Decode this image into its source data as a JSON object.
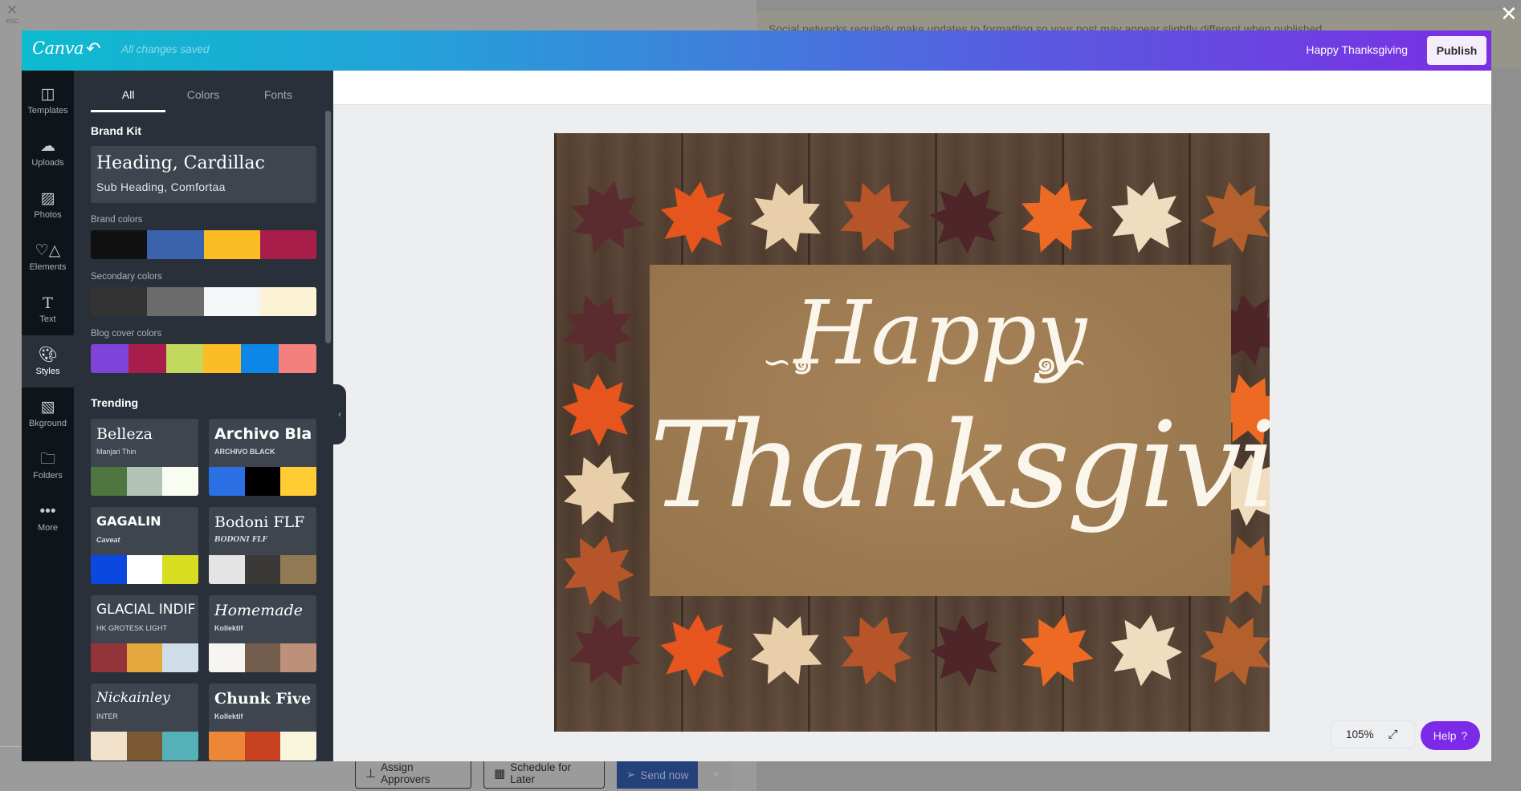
{
  "background": {
    "esc_label": "esc",
    "banner_text": "Social networks regularly make updates to formatting so your post may appear slightly different when published.",
    "buttons": {
      "assign_approvers": "Assign Approvers",
      "schedule_later": "Schedule for Later",
      "send_now": "Send now"
    }
  },
  "header": {
    "logo": "Canva",
    "save_status": "All changes saved",
    "doc_title": "Happy Thanksgiving",
    "publish_label": "Publish"
  },
  "rail": [
    {
      "label": "Templates",
      "icon": "templates-icon"
    },
    {
      "label": "Uploads",
      "icon": "cloud-upload-icon"
    },
    {
      "label": "Photos",
      "icon": "photo-icon"
    },
    {
      "label": "Elements",
      "icon": "shapes-icon"
    },
    {
      "label": "Text",
      "icon": "text-icon"
    },
    {
      "label": "Styles",
      "icon": "palette-icon",
      "active": true
    },
    {
      "label": "Bkground",
      "icon": "background-icon"
    },
    {
      "label": "Folders",
      "icon": "folder-icon"
    },
    {
      "label": "More",
      "icon": "more-icon"
    }
  ],
  "panel": {
    "tabs": [
      "All",
      "Colors",
      "Fonts"
    ],
    "active_tab": "All",
    "brand_kit": {
      "title": "Brand Kit",
      "heading": "Heading, Cardillac",
      "subheading": "Sub Heading, Comfortaa"
    },
    "brand_colors": {
      "title": "Brand colors",
      "colors": [
        "#111111",
        "#3b63ad",
        "#fbbd23",
        "#a91d4b"
      ]
    },
    "secondary_colors": {
      "title": "Secondary colors",
      "colors": [
        "#343334",
        "#6b6b6b",
        "#f4f6f8",
        "#fcf2d6"
      ]
    },
    "blog_cover_colors": {
      "title": "Blog cover colors",
      "colors": [
        "#7e43d8",
        "#a91d4b",
        "#c3d95e",
        "#fbbd23",
        "#0c87e8",
        "#f47f7f"
      ]
    },
    "trending": {
      "title": "Trending",
      "items": [
        {
          "font": "Belleza",
          "sub": "Manjari Thin",
          "colors": [
            "#4f7640",
            "#b1c2b7",
            "#f9fdf1"
          ]
        },
        {
          "font": "Archivo Bla",
          "sub": "ARCHIVO BLACK",
          "colors": [
            "#2a6fe3",
            "#000000",
            "#ffcc33"
          ]
        },
        {
          "font": "GAGALIN",
          "sub": "Caveat",
          "colors": [
            "#0b48e0",
            "#ffffff",
            "#d9dd22"
          ]
        },
        {
          "font": "Bodoni FLF",
          "sub": "BODONI FLF",
          "colors": [
            "#e4e4e4",
            "#3a3937",
            "#907953"
          ]
        },
        {
          "font": "GLACIAL INDIF",
          "sub": "HK GROTESK LIGHT",
          "colors": [
            "#93343b",
            "#e3a73e",
            "#cfdde8"
          ]
        },
        {
          "font": "Homemade",
          "sub": "Kollektif",
          "colors": [
            "#f7f5f2",
            "#735d4d",
            "#bc907a"
          ]
        },
        {
          "font": "Nickainley",
          "sub": "INTER",
          "colors": [
            "#f3e2cb",
            "#7a5933",
            "#55b1b8"
          ]
        },
        {
          "font": "Chunk Five",
          "sub": "Kollektif",
          "colors": [
            "#ee8637",
            "#c7401f",
            "#f8f5dc"
          ]
        }
      ]
    }
  },
  "canvas": {
    "image_alt": "Happy Thanksgiving card with autumn leaves on wood",
    "text_line1": "Happy",
    "text_line2": "Thanksgiving",
    "zoom_level": "105%",
    "help_label": "Help",
    "help_icon": "?"
  }
}
